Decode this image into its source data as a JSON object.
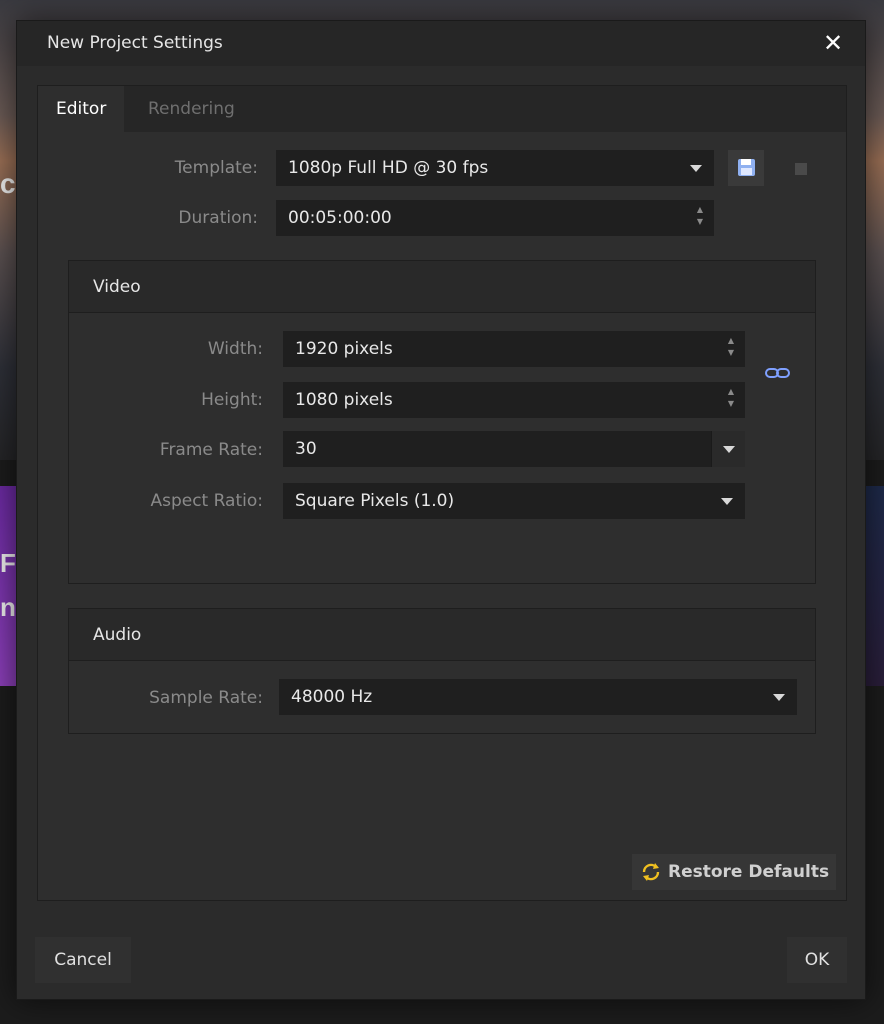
{
  "dialog": {
    "title": "New Project Settings",
    "close_glyph": "✕"
  },
  "tabs": [
    {
      "label": "Editor",
      "active": true
    },
    {
      "label": "Rendering",
      "active": false
    }
  ],
  "general": {
    "template_label": "Template:",
    "template_value": "1080p Full HD @ 30 fps",
    "duration_label": "Duration:",
    "duration_value": "00:05:00:00"
  },
  "video": {
    "title": "Video",
    "width_label": "Width:",
    "width_value": "1920 pixels",
    "height_label": "Height:",
    "height_value": "1080 pixels",
    "frame_rate_label": "Frame Rate:",
    "frame_rate_value": "30",
    "aspect_ratio_label": "Aspect Ratio:",
    "aspect_ratio_value": "Square Pixels (1.0)"
  },
  "audio": {
    "title": "Audio",
    "sample_rate_label": "Sample Rate:",
    "sample_rate_value": "48000 Hz"
  },
  "actions": {
    "restore_defaults": "Restore Defaults",
    "cancel": "Cancel",
    "ok": "OK"
  },
  "icons": {
    "save": "save-icon",
    "delete": "delete-icon",
    "link": "link-icon",
    "restore": "restore-icon"
  },
  "colors": {
    "accent_link": "#7fa0ff",
    "restore_icon": "#f0c020",
    "save_icon": "#8fb0f0"
  }
}
